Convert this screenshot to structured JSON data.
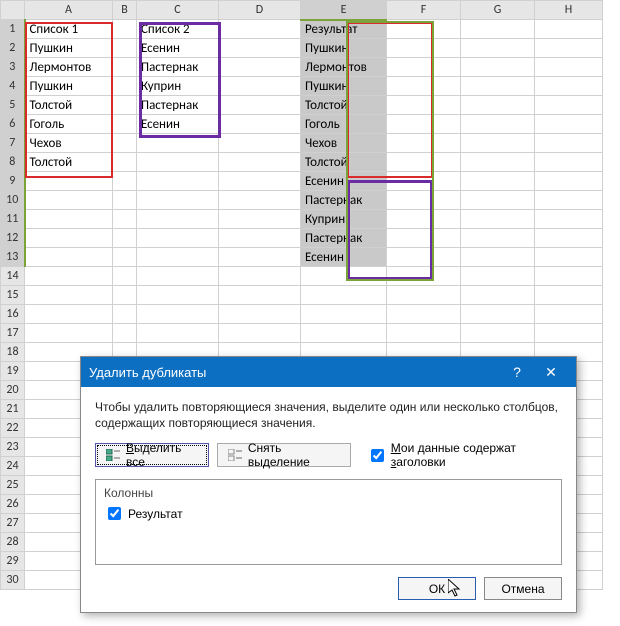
{
  "columns": [
    "A",
    "B",
    "C",
    "D",
    "E",
    "F",
    "G",
    "H"
  ],
  "rows": [
    "1",
    "2",
    "3",
    "4",
    "5",
    "6",
    "7",
    "8",
    "9",
    "10",
    "11",
    "12",
    "13",
    "14",
    "15",
    "16",
    "17",
    "18",
    "19",
    "20",
    "21",
    "22",
    "23",
    "24",
    "25",
    "26",
    "27",
    "28",
    "29",
    "30"
  ],
  "headers": {
    "list1": "Список 1",
    "list2": "Список 2",
    "result": "Результат"
  },
  "list1": [
    "Пушкин",
    "Лермонтов",
    "Пушкин",
    "Толстой",
    "Гоголь",
    "Чехов",
    "Толстой"
  ],
  "list2": [
    "Есенин",
    "Пастернак",
    "Куприн",
    "Пастернак",
    "Есенин"
  ],
  "result": [
    "Пушкин",
    "Лермонтов",
    "Пушкин",
    "Толстой",
    "Гоголь",
    "Чехов",
    "Толстой",
    "Есенин",
    "Пастернак",
    "Куприн",
    "Пастернак",
    "Есенин"
  ],
  "dialog": {
    "title": "Удалить дубликаты",
    "help": "?",
    "close": "✕",
    "instruction": "Чтобы удалить повторяющиеся значения, выделите один или несколько столбцов, содержащих повторяющиеся значения.",
    "selectAll": "Выделить все",
    "deselectAll": "Снять выделение",
    "hasHeaders": "Мои данные содержат заголовки",
    "columnsLabel": "Колонны",
    "columnItem": "Результат",
    "ok": "ОК",
    "cancel": "Отмена"
  }
}
